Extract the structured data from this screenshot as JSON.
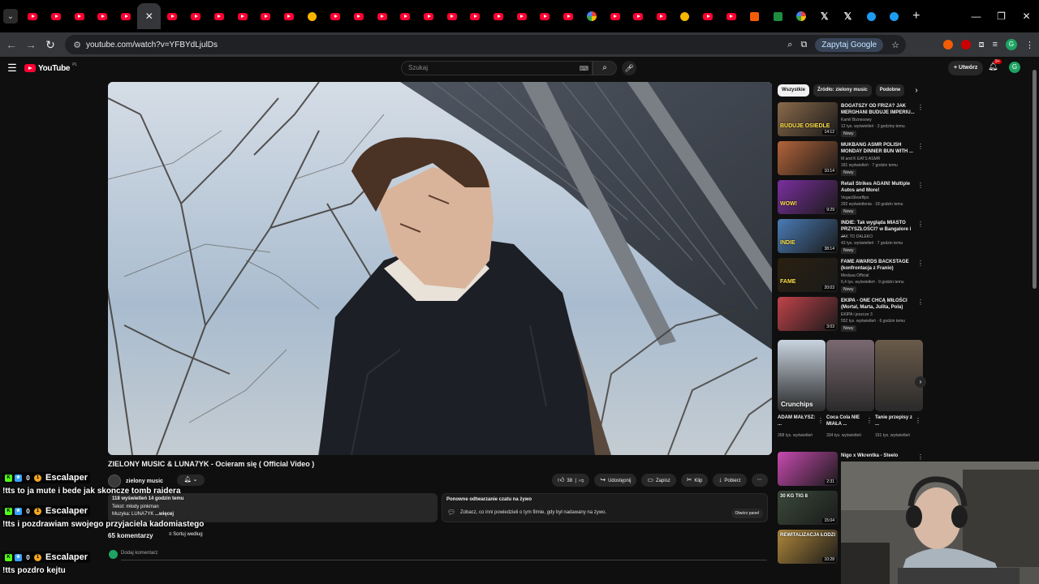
{
  "browser": {
    "tab_count": 39,
    "active_tab_index": 5,
    "tab_kinds": [
      "yt",
      "yt",
      "yt",
      "yt",
      "yt",
      "active",
      "yt",
      "yt",
      "yt",
      "yt",
      "yt",
      "yt",
      "other",
      "yt",
      "yt",
      "yt",
      "yt",
      "yt",
      "yt",
      "yt",
      "yt",
      "yt",
      "yt",
      "yt",
      "g",
      "yt",
      "yt",
      "yt",
      "other",
      "yt",
      "yt",
      "orange",
      "green",
      "g",
      "x",
      "x",
      "blue",
      "blue",
      "end"
    ],
    "url": "youtube.com/watch?v=YFBYdLjulDs",
    "ask_google": "Zapytaj Google",
    "profile_initial": "G"
  },
  "youtube": {
    "logo_text": "YouTube",
    "logo_country": "PL",
    "search_placeholder": "Szukaj",
    "create_label": "Utwórz",
    "notifications_count": "9+",
    "avatar_initial": "G"
  },
  "video": {
    "title_prefix": "ZIELONY MUSIC & LUNA7YK",
    "title_rest": " - Ocieram się ( Official Video )",
    "channel": "zielony music",
    "likes": "38",
    "share": "Udostępnij",
    "save": "Zapisz",
    "clip": "Klip",
    "download": "Pobierz",
    "stats": "118 wyświetleń  14 godzin temu",
    "desc_line1": "Tekst: młody pinkman",
    "desc_line2": "Muzyka: LUNA7YK",
    "desc_more": "...więcej"
  },
  "live_replay": {
    "title": "Ponowne odtwarzanie czatu na żywo",
    "text": "Zobacz, co inni powiedzieli o tym filmie, gdy był nadawany na żywo.",
    "button": "Otwórz panel"
  },
  "comments": {
    "count": "65 komentarzy",
    "sort": "Sortuj według",
    "add_placeholder": "Dodaj komentarz"
  },
  "chips": [
    "Wszystkie",
    "Źródło: zielony music",
    "Podobne"
  ],
  "recommendations": [
    {
      "title": "BOGATSZY OD FRIZA? JAK MERGHANI BUDUJE IMPERIU...",
      "channel": "Kamil Biznesowy",
      "meta": "12 tys. wyświetleń  ·  3 godziny temu",
      "badge": "Nowy",
      "duration": "14:12",
      "thumb_color": "#8a6a4a",
      "thumb_text": "BUDUJE OSIEDLE"
    },
    {
      "title": "MUKBANG ASMR POLISH MONDAY DINNER BUN WITH ...",
      "channel": "M and K EATS ASMR",
      "meta": "181 wyświetleń  ·  7 godzin temu",
      "badge": "Nowy",
      "duration": "10:14",
      "thumb_color": "#b3643a",
      "thumb_text": ""
    },
    {
      "title": "Retail Strikes AGAIN! Multiple Autos and More!",
      "channel": "VegasSlearflips",
      "meta": "292 wyświetlenia  ·  18 godzin temu",
      "badge": "Nowy",
      "duration": "9:29",
      "thumb_color": "#7b2f9e",
      "thumb_text": "WOW!"
    },
    {
      "title": "INDIE: Tak wygląda MIASTO PRZYSZŁOŚCI? w Bangalore i ...",
      "channel": "JAK TO DALEKO",
      "meta": "43 tys. wyświetleń  ·  7 godzin temu",
      "badge": "Nowy",
      "duration": "38:14",
      "thumb_color": "#4a7bb5",
      "thumb_text": "INDIE"
    },
    {
      "title": "FAME AWARDS BACKSTAGE (konfrontacja z Franio)",
      "channel": "Medusa Official",
      "meta": "6,4 tys. wyświetleń  ·  9 godzin temu",
      "badge": "Nowy",
      "duration": "20:03",
      "thumb_color": "#2a2010",
      "thumb_text": "FAME"
    },
    {
      "title": "EKIPA - ONE CHCĄ MIŁOŚCI (Mortal, Marta, Julita, Pola)",
      "channel": "EKIPA  i jeszcze 3",
      "meta": "552 tys. wyświetleń  ·  6 godzin temu",
      "badge": "Nowy",
      "duration": "3:03",
      "thumb_color": "#c0434a",
      "thumb_text": ""
    }
  ],
  "shorts": [
    {
      "title": "ADAM MAŁYSZ: ...",
      "views": "358 tys. wyświetleń",
      "thumb_color": "#c9d4e0",
      "thumb_text": "Crunchips"
    },
    {
      "title": "Coca Cola NIE MIAŁA ...",
      "views": "334 tys. wyświetleń",
      "thumb_color": "#7a6870",
      "thumb_text": ""
    },
    {
      "title": "Tanie przepisy z ...",
      "views": "151 tys. wyświetleń",
      "thumb_color": "#6a5a4a",
      "thumb_text": ""
    }
  ],
  "extra_recommendations": [
    {
      "title": "Nigo x Wkrentka - Steelo",
      "duration": "2:31",
      "thumb_color": "#c84ab0"
    },
    {
      "title": "",
      "duration": "15:04",
      "thumb_color": "#3a4a3a",
      "thumb_text": "30 KG TIG 8"
    },
    {
      "title": "",
      "duration": "10:28",
      "thumb_color": "#b0883a",
      "thumb_text": "REWITALIZACJA ŁODZI"
    }
  ],
  "stream_chat": [
    {
      "user": "Escalaper",
      "badge_num": "0",
      "text": "!tts to ja mute i bede jak skoncze tomb raidera"
    },
    {
      "user": "Escalaper",
      "badge_num": "0",
      "text": "!tts i pozdrawiam swojego przyjaciela kadomiastego"
    },
    {
      "user": "Escalaper",
      "badge_num": "0",
      "text": "!tts pozdro kejtu"
    }
  ]
}
